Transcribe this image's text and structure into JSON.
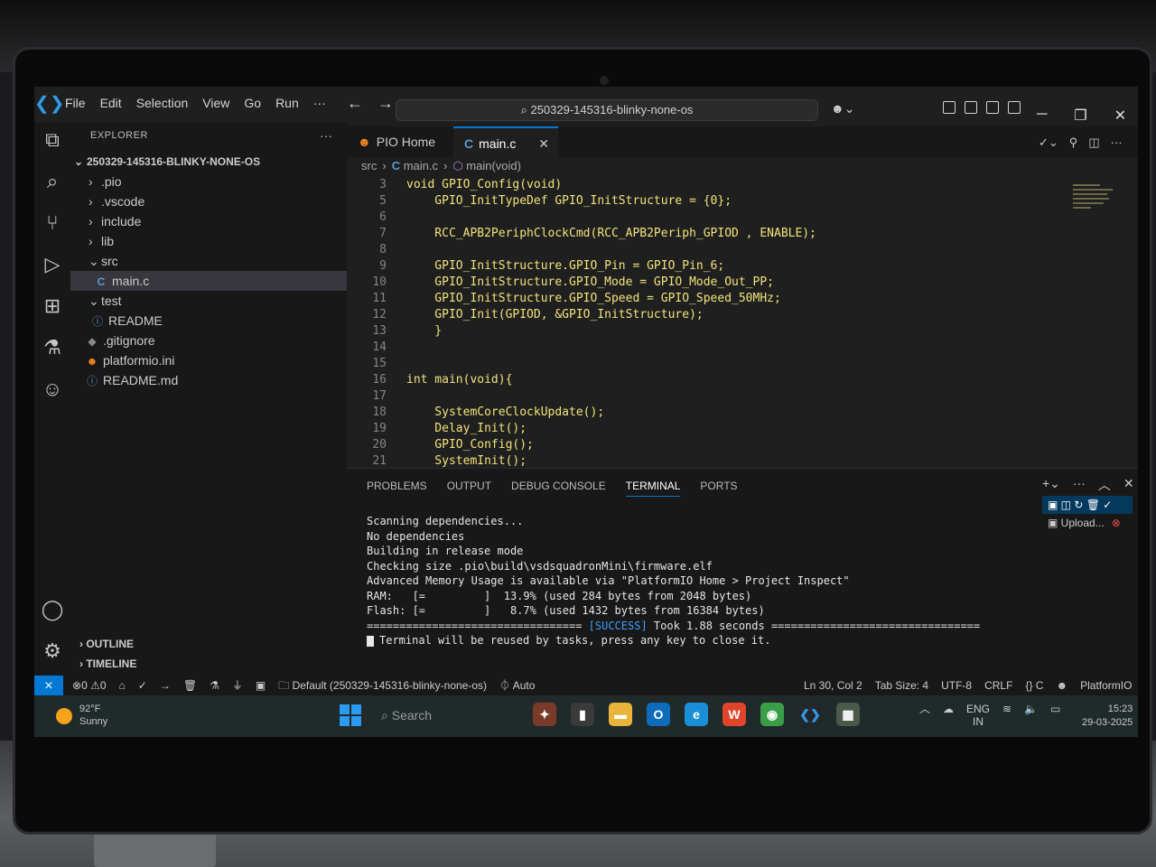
{
  "titlebar": {
    "menu": [
      "File",
      "Edit",
      "Selection",
      "View",
      "Go",
      "Run",
      "···"
    ],
    "command_center": "250329-145316-blinky-none-os",
    "copilot_caret": "⌄"
  },
  "explorer": {
    "title": "EXPLORER",
    "more": "···",
    "project": "250329-145316-BLINKY-NONE-OS",
    "items": [
      {
        "label": ".pio",
        "icon": "chevron-right"
      },
      {
        "label": ".vscode",
        "icon": "chevron-right"
      },
      {
        "label": "include",
        "icon": "chevron-right"
      },
      {
        "label": "lib",
        "icon": "chevron-right"
      },
      {
        "label": "src",
        "icon": "chevron-down"
      },
      {
        "label": "main.c",
        "icon": "c-file",
        "active": true
      },
      {
        "label": "test",
        "icon": "chevron-down"
      },
      {
        "label": "README",
        "icon": "info"
      },
      {
        "label": ".gitignore",
        "icon": "git"
      },
      {
        "label": "platformio.ini",
        "icon": "platformio"
      },
      {
        "label": "README.md",
        "icon": "info"
      }
    ],
    "outline": "OUTLINE",
    "timeline": "TIMELINE"
  },
  "tabs": [
    {
      "label": "PIO Home",
      "icon": "platformio-icon"
    },
    {
      "label": "main.c",
      "icon": "c-file-icon",
      "active": true
    }
  ],
  "breadcrumb": {
    "folder": "src",
    "file": "main.c",
    "symbol": "main(void)"
  },
  "code": [
    {
      "ln": "3",
      "text": "void GPIO_Config(void)"
    },
    {
      "ln": "5",
      "text": "    GPIO_InitTypeDef GPIO_InitStructure = {0};"
    },
    {
      "ln": "6",
      "text": ""
    },
    {
      "ln": "7",
      "text": "    RCC_APB2PeriphClockCmd(RCC_APB2Periph_GPIOD , ENABLE);"
    },
    {
      "ln": "8",
      "text": ""
    },
    {
      "ln": "9",
      "text": "    GPIO_InitStructure.GPIO_Pin = GPIO_Pin_6;"
    },
    {
      "ln": "10",
      "text": "    GPIO_InitStructure.GPIO_Mode = GPIO_Mode_Out_PP;"
    },
    {
      "ln": "11",
      "text": "    GPIO_InitStructure.GPIO_Speed = GPIO_Speed_50MHz;"
    },
    {
      "ln": "12",
      "text": "    GPIO_Init(GPIOD, &GPIO_InitStructure);"
    },
    {
      "ln": "13",
      "text": "    }"
    },
    {
      "ln": "14",
      "text": ""
    },
    {
      "ln": "15",
      "text": ""
    },
    {
      "ln": "16",
      "text": "int main(void){"
    },
    {
      "ln": "17",
      "text": ""
    },
    {
      "ln": "18",
      "text": "    SystemCoreClockUpdate();"
    },
    {
      "ln": "19",
      "text": "    Delay_Init();"
    },
    {
      "ln": "20",
      "text": "    GPIO_Config();"
    },
    {
      "ln": "21",
      "text": "    SystemInit();"
    }
  ],
  "panel": {
    "tabs": [
      "PROBLEMS",
      "OUTPUT",
      "DEBUG CONSOLE",
      "TERMINAL",
      "PORTS"
    ],
    "active_tab": "TERMINAL",
    "terminal_instance": "Upload...",
    "terminal_lines": [
      "Scanning dependencies...",
      "No dependencies",
      "Building in release mode",
      "Checking size .pio\\build\\vsdsquadronMini\\firmware.elf",
      "Advanced Memory Usage is available via \"PlatformIO Home > Project Inspect\"",
      "RAM:   [=         ]  13.9% (used 284 bytes from 2048 bytes)",
      "Flash: [=         ]   8.7% (used 1432 bytes from 16384 bytes)"
    ],
    "success_left": "================================= ",
    "success_tag": "[SUCCESS]",
    "success_right": " Took 1.88 seconds ================================",
    "reuse_msg": "Terminal will be reused by tasks, press any key to close it."
  },
  "statusbar": {
    "errors": "0",
    "warnings": "0",
    "env": "Default (250329-145316-blinky-none-os)",
    "auto": "Auto",
    "position": "Ln 30, Col 2",
    "tab_size": "Tab Size: 4",
    "encoding": "UTF-8",
    "eol": "CRLF",
    "language": "C",
    "platformio": "PlatformIO"
  },
  "taskbar": {
    "temp": "92°F",
    "condition": "Sunny",
    "search": "Search",
    "lang_1": "ENG",
    "lang_2": "IN",
    "time": "15:23",
    "date": "29-03-2025"
  },
  "colors": {
    "accent": "#0078d4",
    "code_fn": "#f2e37a",
    "success": "#3ea0ff"
  }
}
